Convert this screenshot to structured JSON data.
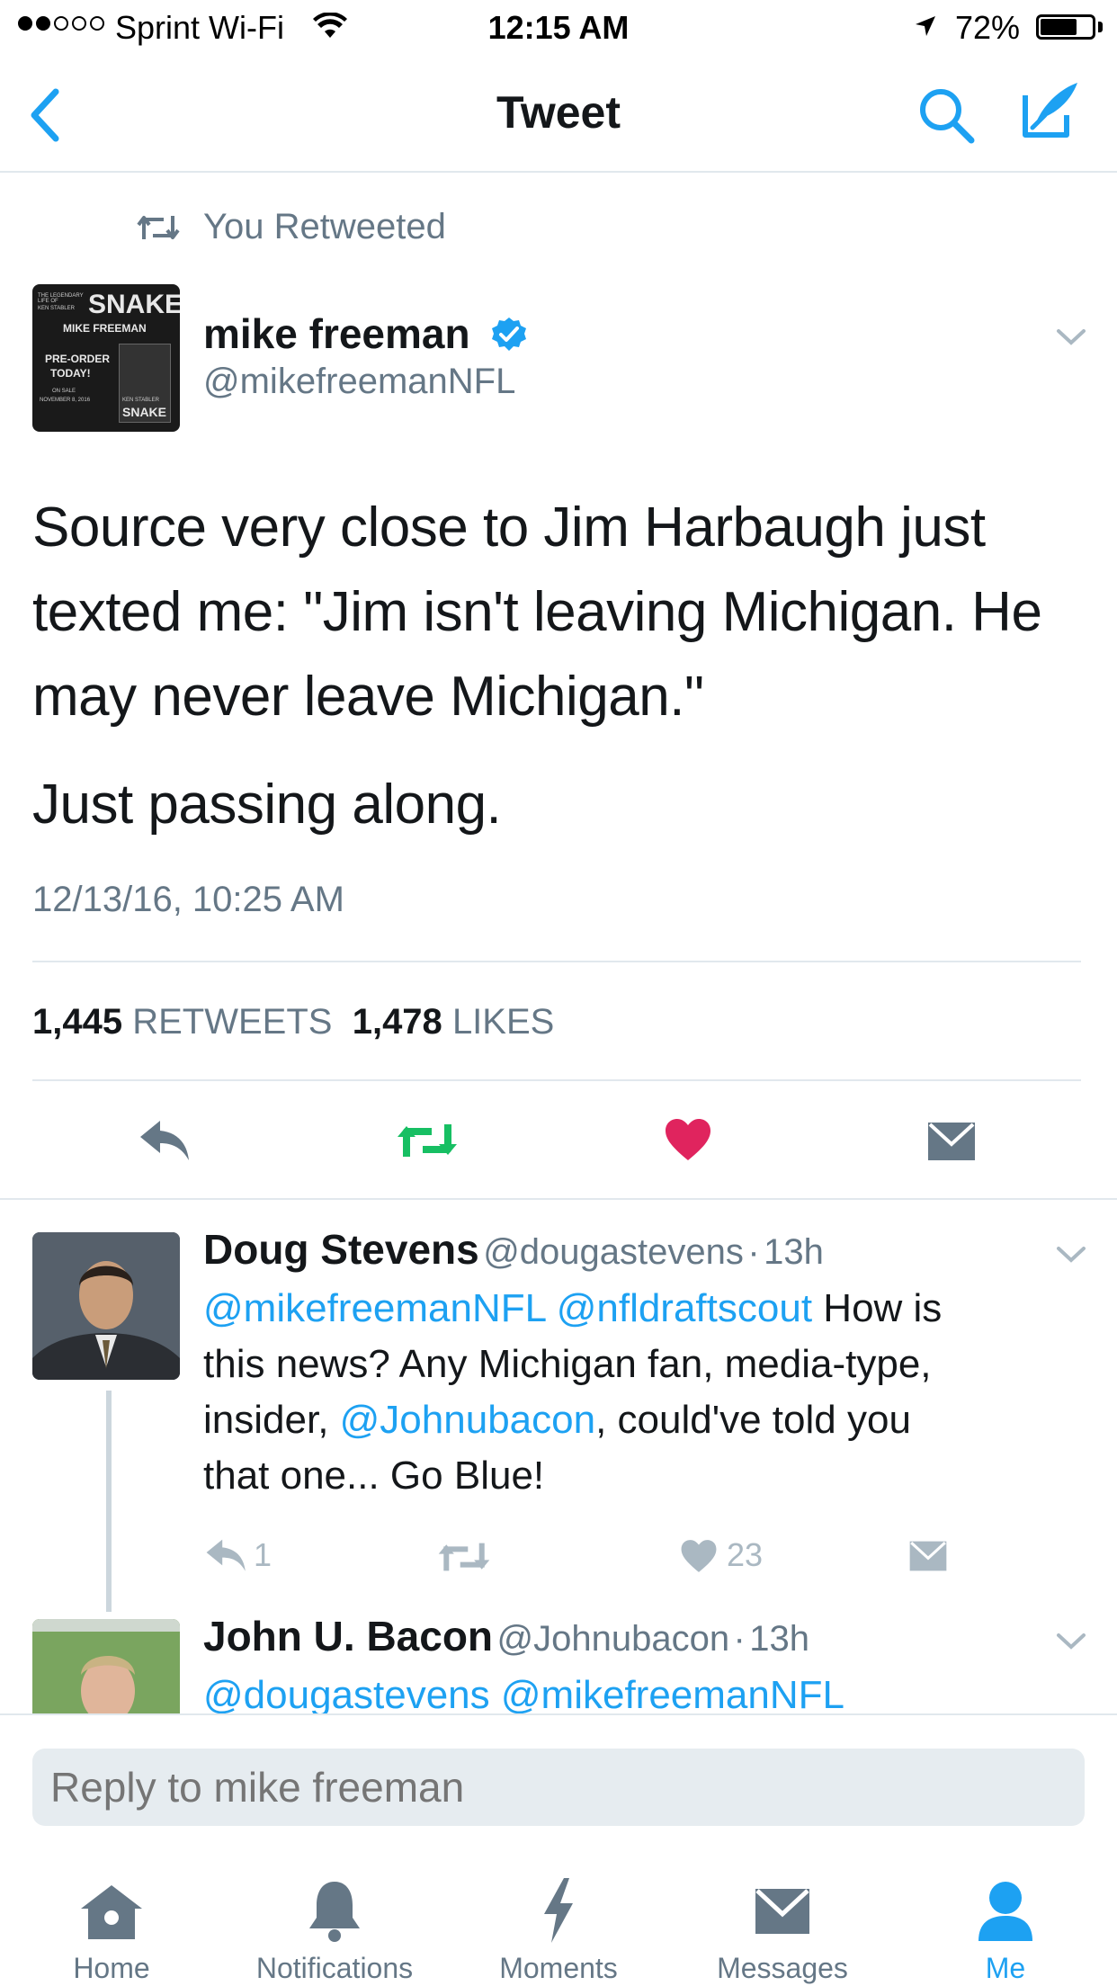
{
  "status_bar": {
    "carrier": "Sprint Wi-Fi",
    "time": "12:15 AM",
    "battery": "72%",
    "battery_level": 0.72
  },
  "nav": {
    "title": "Tweet"
  },
  "tweet": {
    "retweet_label": "You Retweeted",
    "author_name": "mike freeman",
    "author_handle": "@mikefreemanNFL",
    "avatar_lines": [
      "THE LEGENDARY LIFE OF",
      "KEN STABLER",
      "SNAKE",
      "MIKE FREEMAN",
      "PRE-ORDER",
      "TODAY!",
      "ON SALE",
      "NOVEMBER 8, 2016",
      "KEN STABLER",
      "SNAKE"
    ],
    "text_lines": [
      "Source very close to Jim Harbaugh just",
      "texted me: \"Jim isn't leaving Michigan. He",
      "may never leave Michigan.\""
    ],
    "text_line_2": "Just passing along.",
    "timestamp": "12/13/16, 10:25 AM",
    "retweets_count": "1,445",
    "retweets_label": "RETWEETS",
    "likes_count": "1,478",
    "likes_label": "LIKES"
  },
  "replies": [
    {
      "name": "Doug Stevens",
      "handle": "@dougastevens",
      "time": "13h",
      "mention1": "@mikefreemanNFL",
      "mention2": "@nfldraftscout",
      "text_a": " How is",
      "line2": "this news?  Any Michigan fan, media-type,",
      "line3_pre": "insider, ",
      "mention3": "@Johnubacon",
      "line3_post": ", could've told you",
      "line4": "that one... Go Blue!",
      "reply_count": "1",
      "like_count": "23"
    },
    {
      "name": "John U. Bacon",
      "handle": "@Johnubacon",
      "time": "13h",
      "mention1": "@dougastevens",
      "mention2": "@mikefreemanNFL"
    }
  ],
  "composer": {
    "placeholder": "Reply to mike freeman"
  },
  "tabs": [
    {
      "label": "Home",
      "icon": "home-icon"
    },
    {
      "label": "Notifications",
      "icon": "bell-icon"
    },
    {
      "label": "Moments",
      "icon": "lightning-icon"
    },
    {
      "label": "Messages",
      "icon": "envelope-icon"
    },
    {
      "label": "Me",
      "icon": "person-icon"
    }
  ],
  "colors": {
    "accent": "#1da1f2",
    "retweet_green": "#17bf63",
    "like_red": "#e0245e",
    "gray": "#657786"
  }
}
